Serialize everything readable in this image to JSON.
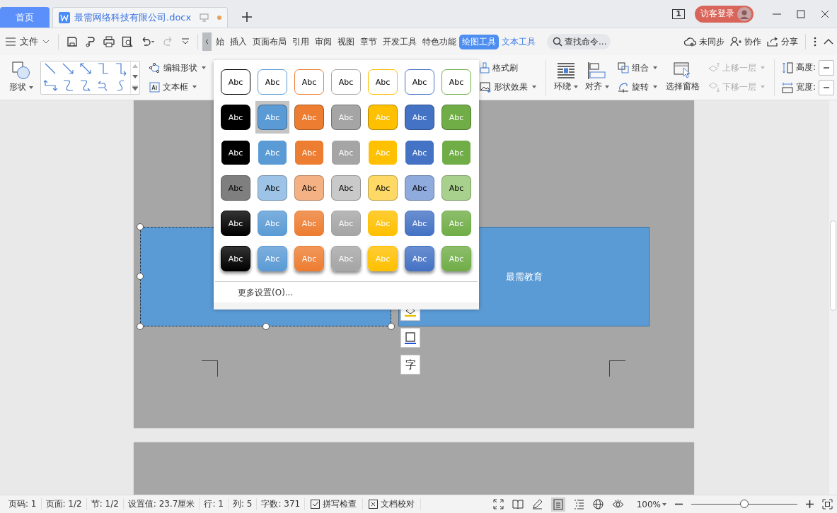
{
  "tabs": [
    {
      "label": "首页",
      "kind": "home",
      "selected": false
    },
    {
      "label": "最需网络科技有限公司.docx",
      "kind": "document",
      "selected": true
    }
  ],
  "title_bar": {
    "page_count": "1",
    "login": "访客登录"
  },
  "quick_bar": {
    "file_menu": "文件"
  },
  "menu_tabs": [
    {
      "label": "始",
      "kind": "main",
      "selected": false
    },
    {
      "label": "插入",
      "kind": "main",
      "selected": false
    },
    {
      "label": "页面布局",
      "kind": "main",
      "selected": false
    },
    {
      "label": "引用",
      "kind": "main",
      "selected": false
    },
    {
      "label": "审阅",
      "kind": "main",
      "selected": false
    },
    {
      "label": "视图",
      "kind": "main",
      "selected": false
    },
    {
      "label": "章节",
      "kind": "main",
      "selected": false
    },
    {
      "label": "开发工具",
      "kind": "main",
      "selected": false
    },
    {
      "label": "特色功能",
      "kind": "main",
      "selected": false
    },
    {
      "label": "绘图工具",
      "kind": "context",
      "selected": true
    },
    {
      "label": "文本工具",
      "kind": "context",
      "selected": false
    }
  ],
  "search": {
    "placeholder": "查找命令..."
  },
  "actions": [
    {
      "label": "未同步",
      "kind": "sync"
    },
    {
      "label": "协作",
      "kind": "collab"
    },
    {
      "label": "分享",
      "kind": "share"
    }
  ],
  "ribbon": {
    "shape": "形状",
    "edit_shape": "编辑形状",
    "text_box": "文本框",
    "format_painter": "格式刷",
    "shape_effects": "形状效果",
    "wrap": "环绕",
    "align": "对齐",
    "group": "组合",
    "rotate": "旋转",
    "selection_pane": "选择窗格",
    "layers": [
      {
        "label": "上移一层",
        "kind": "up",
        "disabled": true
      },
      {
        "label": "下移一层",
        "kind": "down",
        "disabled": true
      }
    ],
    "height_label": "高度:",
    "width_label": "宽度:"
  },
  "style_gallery": {
    "rows": [
      {
        "kind": "outline",
        "cells": [
          {
            "label": "Abc",
            "color": "#000000",
            "selected": false
          },
          {
            "label": "Abc",
            "color": "#5b9bd5",
            "selected": false
          },
          {
            "label": "Abc",
            "color": "#ed7d31",
            "selected": false
          },
          {
            "label": "Abc",
            "color": "#a5a5a5",
            "selected": false
          },
          {
            "label": "Abc",
            "color": "#ffc000",
            "selected": false
          },
          {
            "label": "Abc",
            "color": "#4472c4",
            "selected": false
          },
          {
            "label": "Abc",
            "color": "#70ad47",
            "selected": false
          }
        ]
      },
      {
        "kind": "bordered",
        "cells": [
          {
            "label": "Abc",
            "color": "#000000",
            "selected": false
          },
          {
            "label": "Abc",
            "color": "#5b9bd5",
            "selected": true
          },
          {
            "label": "Abc",
            "color": "#ed7d31",
            "selected": false
          },
          {
            "label": "Abc",
            "color": "#a5a5a5",
            "selected": false
          },
          {
            "label": "Abc",
            "color": "#ffc000",
            "selected": false
          },
          {
            "label": "Abc",
            "color": "#4472c4",
            "selected": false
          },
          {
            "label": "Abc",
            "color": "#70ad47",
            "selected": false
          }
        ]
      },
      {
        "kind": "filled",
        "cells": [
          {
            "label": "Abc",
            "color": "#000000",
            "selected": false
          },
          {
            "label": "Abc",
            "color": "#5b9bd5",
            "selected": false
          },
          {
            "label": "Abc",
            "color": "#ed7d31",
            "selected": false
          },
          {
            "label": "Abc",
            "color": "#a5a5a5",
            "selected": false
          },
          {
            "label": "Abc",
            "color": "#ffc000",
            "selected": false
          },
          {
            "label": "Abc",
            "color": "#4472c4",
            "selected": false
          },
          {
            "label": "Abc",
            "color": "#70ad47",
            "selected": false
          }
        ]
      },
      {
        "kind": "light",
        "cells": [
          {
            "label": "Abc",
            "color": "#7f7f7f",
            "selected": false
          },
          {
            "label": "Abc",
            "color": "#9dc3e6",
            "selected": false
          },
          {
            "label": "Abc",
            "color": "#f4b183",
            "selected": false
          },
          {
            "label": "Abc",
            "color": "#c9c9c9",
            "selected": false
          },
          {
            "label": "Abc",
            "color": "#ffd966",
            "selected": false
          },
          {
            "label": "Abc",
            "color": "#8faadc",
            "selected": false
          },
          {
            "label": "Abc",
            "color": "#a9d18e",
            "selected": false
          }
        ]
      },
      {
        "kind": "gradient",
        "cells": [
          {
            "label": "Abc",
            "color": "#000000",
            "selected": false
          },
          {
            "label": "Abc",
            "color": "#5b9bd5",
            "selected": false
          },
          {
            "label": "Abc",
            "color": "#ed7d31",
            "selected": false
          },
          {
            "label": "Abc",
            "color": "#a5a5a5",
            "selected": false
          },
          {
            "label": "Abc",
            "color": "#ffc000",
            "selected": false
          },
          {
            "label": "Abc",
            "color": "#4472c4",
            "selected": false
          },
          {
            "label": "Abc",
            "color": "#70ad47",
            "selected": false
          }
        ]
      },
      {
        "kind": "shadow",
        "cells": [
          {
            "label": "Abc",
            "color": "#000000",
            "selected": false
          },
          {
            "label": "Abc",
            "color": "#5b9bd5",
            "selected": false
          },
          {
            "label": "Abc",
            "color": "#ed7d31",
            "selected": false
          },
          {
            "label": "Abc",
            "color": "#a5a5a5",
            "selected": false
          },
          {
            "label": "Abc",
            "color": "#ffc000",
            "selected": false
          },
          {
            "label": "Abc",
            "color": "#4472c4",
            "selected": false
          },
          {
            "label": "Abc",
            "color": "#70ad47",
            "selected": false
          }
        ]
      }
    ],
    "more": "更多设置(O)..."
  },
  "document": {
    "shapes": [
      {
        "kind": "selected"
      },
      {
        "kind": "plain",
        "text": "最需教育"
      }
    ],
    "text_tool": "字"
  },
  "status_bar": {
    "items": [
      "页码: 1",
      "页面: 1/2",
      "节: 1/2",
      "设置值: 23.7厘米",
      "行: 1",
      "列: 5",
      "字数: 371"
    ],
    "buttons": [
      "拼写检查",
      "文档校对"
    ],
    "zoom": "100%",
    "zoom_slider": {
      "level": 0.5
    }
  }
}
